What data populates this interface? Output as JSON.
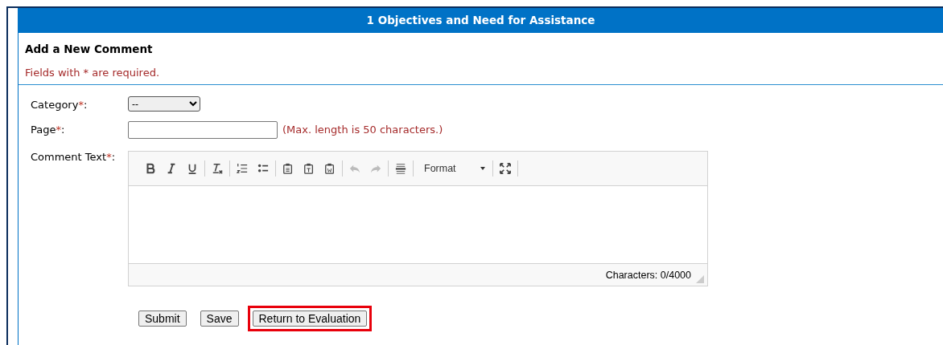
{
  "header": {
    "title": "1 Objectives and Need for Assistance"
  },
  "section": {
    "title": "Add a New Comment",
    "note": "Fields with * are required."
  },
  "fields": [
    {
      "label": "Category",
      "required_mark": "*",
      "suffix": ":",
      "kind": "select",
      "value": "--"
    },
    {
      "label": "Page",
      "required_mark": "*",
      "suffix": ":",
      "kind": "text",
      "hint": "(Max. length is 50 characters.)"
    },
    {
      "label": "Comment Text",
      "required_mark": "*",
      "suffix": ":",
      "kind": "editor"
    }
  ],
  "editor": {
    "toolbar": [
      [
        {
          "kind": "bold",
          "disabled": false
        },
        {
          "kind": "italic",
          "disabled": false
        },
        {
          "kind": "underline",
          "disabled": false
        }
      ],
      [
        {
          "kind": "clear-format",
          "disabled": false
        }
      ],
      [
        {
          "kind": "numbered-list",
          "disabled": false
        },
        {
          "kind": "bulleted-list",
          "disabled": false
        }
      ],
      [
        {
          "kind": "paste",
          "disabled": false
        },
        {
          "kind": "paste-text",
          "disabled": false
        },
        {
          "kind": "paste-word",
          "disabled": false
        }
      ],
      [
        {
          "kind": "undo",
          "disabled": true
        },
        {
          "kind": "redo",
          "disabled": true
        }
      ],
      [
        {
          "kind": "horizontal-rule",
          "disabled": false
        }
      ],
      [
        {
          "kind": "format",
          "label": "Format"
        }
      ],
      [
        {
          "kind": "maximize",
          "disabled": false
        }
      ]
    ],
    "counter": "Characters: 0/4000"
  },
  "buttons": [
    {
      "label": "Submit",
      "highlighted": false
    },
    {
      "label": "Save",
      "highlighted": false
    },
    {
      "label": "Return to Evaluation",
      "highlighted": true
    }
  ]
}
